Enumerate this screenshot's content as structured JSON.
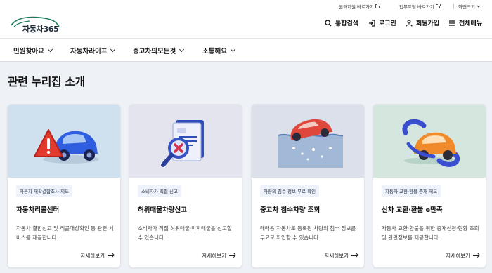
{
  "header": {
    "logo_text": "자동차365",
    "util_links": [
      {
        "label": "원격지원 바로가기",
        "icon": "external-link-icon"
      },
      {
        "label": "업무포털 바로가기",
        "icon": "external-link-icon"
      },
      {
        "label": "화면크기",
        "icon": "chevron-down-icon"
      }
    ],
    "gnb": [
      {
        "label": "통합검색",
        "icon": "search-icon"
      },
      {
        "label": "로그인",
        "icon": "login-icon"
      },
      {
        "label": "회원가입",
        "icon": "user-icon"
      },
      {
        "label": "전체메뉴",
        "icon": "menu-icon"
      }
    ]
  },
  "nav": {
    "items": [
      {
        "label": "민원찾아요"
      },
      {
        "label": "자동차라이프"
      },
      {
        "label": "중고차의모든것"
      },
      {
        "label": "소통해요"
      }
    ]
  },
  "main": {
    "title": "관련 누리집 소개",
    "cards": [
      {
        "tag": "자동차 제작결함조사 제도",
        "title": "자동차리콜센터",
        "desc": "자동차 결함신고 및 리콜대상확인 등 관련 서비스를 제공합니다.",
        "more": "자세히보기",
        "bg": "#cfe0ee",
        "illustration": "recall-car-warning-icon"
      },
      {
        "tag": "소비자가 직접 신고",
        "title": "허위매물차량신고",
        "desc": "소비자가 직접 허위매물·미끼매물을 신고할 수 있습니다.",
        "more": "자세히보기",
        "bg": "#e3e4ee",
        "illustration": "document-search-icon"
      },
      {
        "tag": "차량의 침수 정보 무료 확인",
        "title": "중고차 침수차량 조회",
        "desc": "매매용 자동차로 등록된 차량의 침수 정보를 무료로 확인할 수 있습니다.",
        "more": "자세히보기",
        "bg": "#dbe0ea",
        "illustration": "flooded-car-icon"
      },
      {
        "tag": "자동차 교환·환불 중재 제도",
        "title": "신차 교환·환불 e만족",
        "desc": "자동차 교환·환불을 위한 중재신청·현황 조회 및 관련정보를 제공합니다.",
        "more": "자세히보기",
        "bg": "#d5e6df",
        "illustration": "car-exchange-icon"
      }
    ]
  }
}
